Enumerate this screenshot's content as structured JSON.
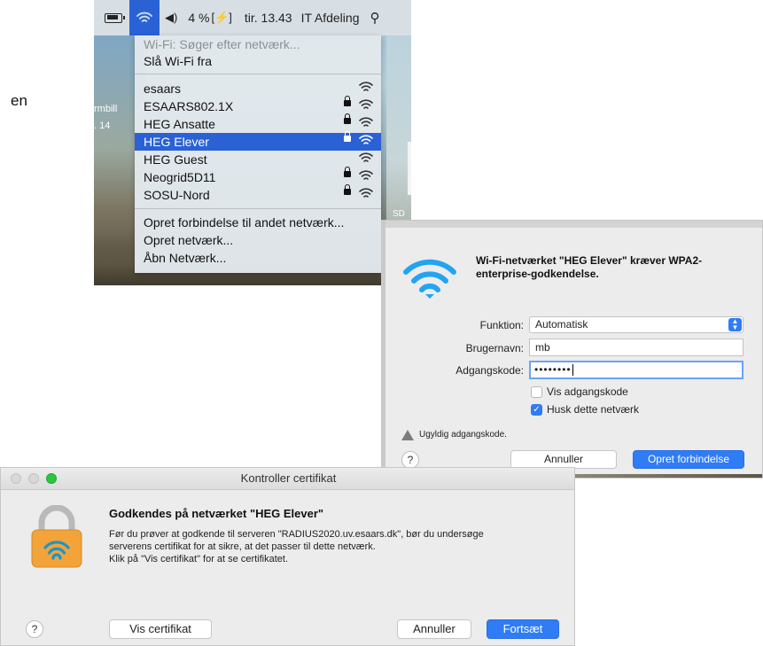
{
  "menu_bar": {
    "battery_percent": "4 %",
    "clock": "tir. 13.43",
    "user": "IT Afdeling"
  },
  "desktop": {
    "partial_text": "en",
    "label_1": "rmbill",
    "label_2": ". 14",
    "label_3": "SD"
  },
  "wifi_menu": {
    "status": "Wi-Fi: Søger efter netværk...",
    "turn_off": "Slå Wi-Fi fra",
    "networks": [
      {
        "name": "esaars",
        "locked": false,
        "selected": false
      },
      {
        "name": "ESAARS802.1X",
        "locked": true,
        "selected": false
      },
      {
        "name": "HEG Ansatte",
        "locked": true,
        "selected": false
      },
      {
        "name": "HEG Elever",
        "locked": true,
        "selected": true
      },
      {
        "name": "HEG Guest",
        "locked": false,
        "selected": false
      },
      {
        "name": "Neogrid5D11",
        "locked": true,
        "selected": false
      },
      {
        "name": "SOSU-Nord",
        "locked": true,
        "selected": false
      }
    ],
    "join_other": "Opret forbindelse til andet netværk...",
    "create_network": "Opret netværk...",
    "open_prefs": "Åbn Netværk..."
  },
  "wpa_dialog": {
    "message": "Wi-Fi-netværket \"HEG Elever\" kræver WPA2-enterprise-godkendelse.",
    "function_label": "Funktion:",
    "function_value": "Automatisk",
    "username_label": "Brugernavn:",
    "username_value": "mb",
    "password_label": "Adgangskode:",
    "password_value": "••••••••",
    "show_password_label": "Vis adgangskode",
    "show_password_checked": false,
    "remember_label": "Husk dette netværk",
    "remember_checked": true,
    "warning": "Ugyldig adgangskode.",
    "help": "?",
    "cancel": "Annuller",
    "connect": "Opret forbindelse"
  },
  "cert_dialog": {
    "title": "Kontroller certifikat",
    "heading": "Godkendes på netværket \"HEG Elever\"",
    "body_line_1": "Før du prøver at godkende til serveren \"RADIUS2020.uv.esaars.dk\", bør du undersøge",
    "body_line_2": "serverens certifikat for at sikre, at det passer til dette netværk.",
    "body_line_3": "Klik på \"Vis certifikat\" for at se certifikatet.",
    "help": "?",
    "show_certificate": "Vis certifikat",
    "cancel": "Annuller",
    "continue": "Fortsæt"
  },
  "colors": {
    "accent": "#2f7cf6",
    "menu_highlight": "#2a62d6",
    "wifi_icon": "#23a4f0",
    "lock_gold": "#f2a43a"
  }
}
